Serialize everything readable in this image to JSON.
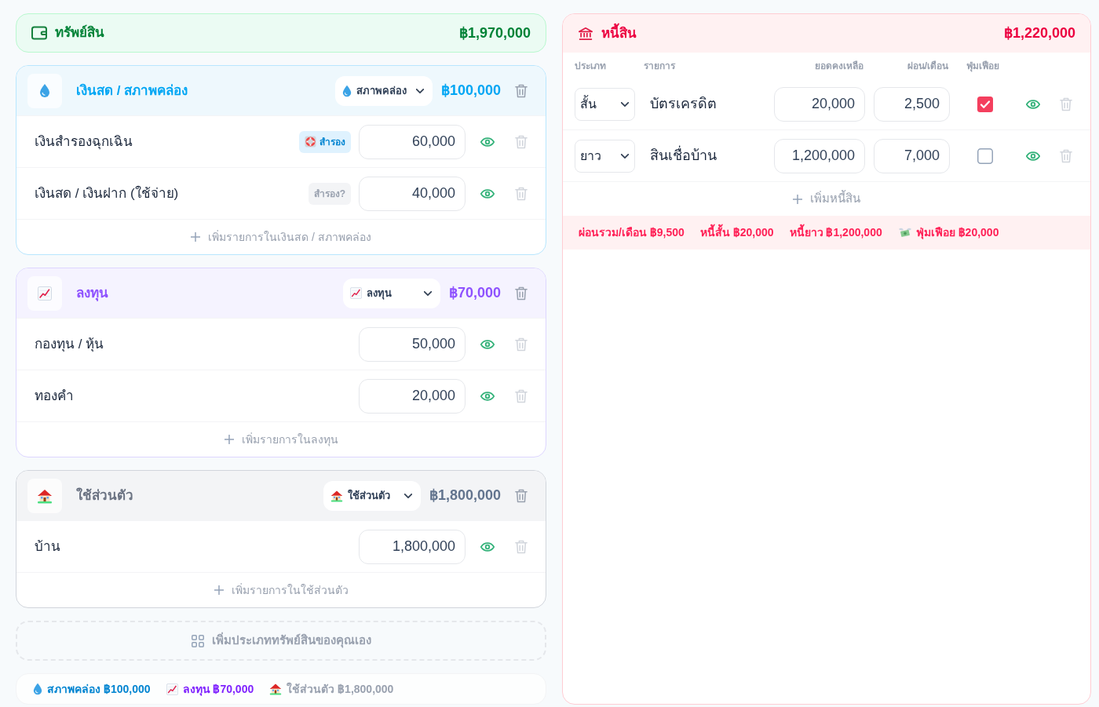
{
  "assets": {
    "title": "ทรัพย์สิน",
    "total": "฿1,970,000",
    "categories": [
      {
        "kind": "liquid",
        "title": "เงินสด / สภาพคล่อง",
        "select": "สภาพคล่อง",
        "total": "฿100,000",
        "items": [
          {
            "label": "เงินสำรองฉุกเฉิน",
            "badge": {
              "label": "สำรอง",
              "selected": true
            },
            "value": "60,000"
          },
          {
            "label": "เงินสด / เงินฝาก (ใช้จ่าย)",
            "badge": {
              "label": "สำรอง?",
              "selected": false
            },
            "value": "40,000"
          }
        ],
        "add_label": "เพิ่มรายการในเงินสด / สภาพคล่อง"
      },
      {
        "kind": "investment",
        "title": "ลงทุน",
        "select": "ลงทุน",
        "total": "฿70,000",
        "items": [
          {
            "label": "กองทุน / หุ้น",
            "value": "50,000"
          },
          {
            "label": "ทองคำ",
            "value": "20,000"
          }
        ],
        "add_label": "เพิ่มรายการในลงทุน"
      },
      {
        "kind": "personal",
        "title": "ใช้ส่วนตัว",
        "select": "ใช้ส่วนตัว",
        "total": "฿1,800,000",
        "items": [
          {
            "label": "บ้าน",
            "value": "1,800,000"
          }
        ],
        "add_label": "เพิ่มรายการในใช้ส่วนตัว"
      }
    ],
    "add_category": "เพิ่มประเภททรัพย์สินของคุณเอง",
    "summary": [
      {
        "kind": "liquid",
        "text": "สภาพคล่อง ฿100,000"
      },
      {
        "kind": "investment",
        "text": "ลงทุน ฿70,000"
      },
      {
        "kind": "personal",
        "text": "ใช้ส่วนตัว ฿1,800,000"
      }
    ]
  },
  "liabilities": {
    "title": "หนี้สิน",
    "total": "฿1,220,000",
    "columns": [
      "ประเภท",
      "รายการ",
      "ยอดคงเหลือ",
      "ผ่อน/เดือน",
      "ฟุ่มเฟือย"
    ],
    "rows": [
      {
        "term": "สั้น",
        "name": "บัตรเครดิต",
        "balance": "20,000",
        "monthly": "2,500",
        "checked": true
      },
      {
        "term": "ยาว",
        "name": "สินเชื่อบ้าน",
        "balance": "1,200,000",
        "monthly": "7,000",
        "checked": false
      }
    ],
    "add_label": "เพิ่มหนี้สิน",
    "summary": [
      {
        "kind": "plain",
        "text": "ผ่อนรวม/เดือน ฿9,500"
      },
      {
        "kind": "plain",
        "text": "หนี้สั้น ฿20,000"
      },
      {
        "kind": "plain",
        "text": "หนี้ยาว ฿1,200,000"
      },
      {
        "kind": "luxury",
        "text": "ฟุ่มเฟือย ฿20,000"
      }
    ]
  }
}
